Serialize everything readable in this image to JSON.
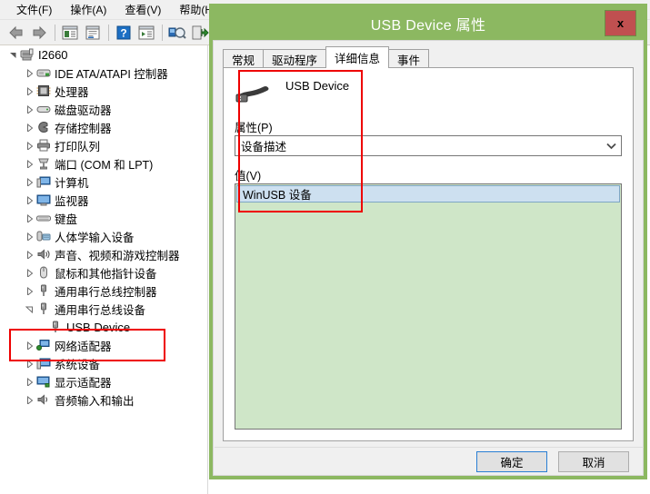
{
  "menubar": {
    "items": [
      {
        "label": "文件(F)",
        "name": "menu-file"
      },
      {
        "label": "操作(A)",
        "name": "menu-action"
      },
      {
        "label": "查看(V)",
        "name": "menu-view"
      },
      {
        "label": "帮助(H)",
        "name": "menu-help"
      }
    ]
  },
  "toolbar": {
    "buttons": [
      {
        "name": "back-icon",
        "glyph": "back"
      },
      {
        "name": "forward-icon",
        "glyph": "forward"
      },
      {
        "name": "show-hidden-devices-icon",
        "glyph": "listwin"
      },
      {
        "name": "properties-icon",
        "glyph": "propwin"
      },
      {
        "name": "help-icon",
        "glyph": "help"
      },
      {
        "name": "update-driver-icon",
        "glyph": "playwin"
      },
      {
        "name": "scan-hardware-changes-icon",
        "glyph": "scan"
      },
      {
        "name": "uninstall-device-icon",
        "glyph": "uninstall"
      }
    ]
  },
  "tree": {
    "root": {
      "label": "I2660",
      "icon": "computer-icon",
      "expanded": true
    },
    "nodes": [
      {
        "label": "IDE ATA/ATAPI 控制器",
        "icon": "ide-icon"
      },
      {
        "label": "处理器",
        "icon": "processor-icon"
      },
      {
        "label": "磁盘驱动器",
        "icon": "disk-icon"
      },
      {
        "label": "存储控制器",
        "icon": "storage-icon"
      },
      {
        "label": "打印队列",
        "icon": "printer-icon"
      },
      {
        "label": "端口 (COM 和 LPT)",
        "icon": "port-icon"
      },
      {
        "label": "计算机",
        "icon": "computer-small-icon"
      },
      {
        "label": "监视器",
        "icon": "monitor-icon"
      },
      {
        "label": "键盘",
        "icon": "keyboard-icon"
      },
      {
        "label": "人体学输入设备",
        "icon": "hid-icon"
      },
      {
        "label": "声音、视频和游戏控制器",
        "icon": "sound-icon"
      },
      {
        "label": "鼠标和其他指针设备",
        "icon": "mouse-icon"
      },
      {
        "label": "通用串行总线控制器",
        "icon": "usb-icon"
      },
      {
        "label": "通用串行总线设备",
        "icon": "usb-icon",
        "expanded": true,
        "highlighted": true
      },
      {
        "label": "USB Device",
        "icon": "usb-device-icon",
        "child": true,
        "highlighted": true
      },
      {
        "label": "网络适配器",
        "icon": "network-icon"
      },
      {
        "label": "系统设备",
        "icon": "system-icon"
      },
      {
        "label": "显示适配器",
        "icon": "display-icon"
      },
      {
        "label": "音频输入和输出",
        "icon": "audio-icon"
      }
    ]
  },
  "dialog": {
    "title": "USB Device 属性",
    "close_label": "x",
    "frame_color": "#8cb861",
    "close_color": "#c05050",
    "tabs": [
      {
        "label": "常规",
        "name": "tab-general",
        "active": false
      },
      {
        "label": "驱动程序",
        "name": "tab-driver",
        "active": false
      },
      {
        "label": "详细信息",
        "name": "tab-details",
        "active": true
      },
      {
        "label": "事件",
        "name": "tab-events",
        "active": false
      }
    ],
    "device_name": "USB Device",
    "device_icon": "usb-connector-icon",
    "property_label": "属性(P)",
    "property_value": "设备描述",
    "value_label": "值(V)",
    "value_items": [
      "WinUSB 设备"
    ],
    "buttons": {
      "ok": "确定",
      "cancel": "取消"
    },
    "annotation_color": "#ee0000"
  }
}
